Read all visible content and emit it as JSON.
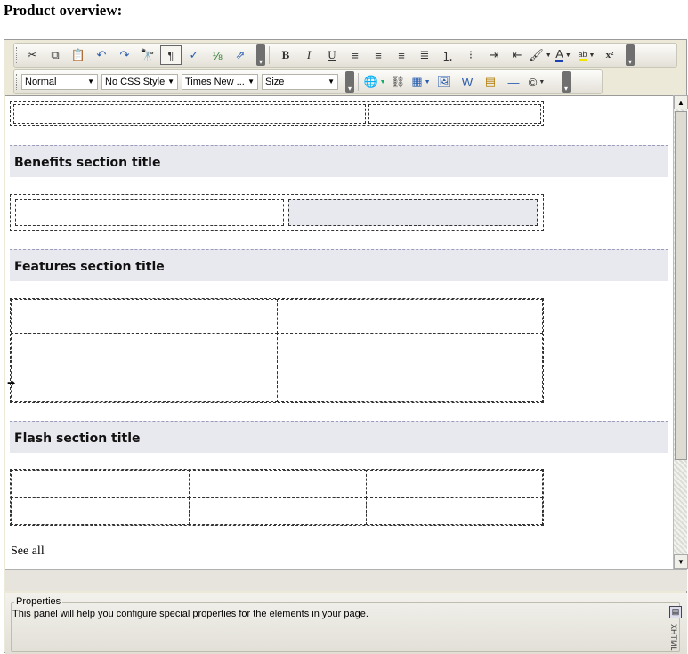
{
  "page": {
    "label": "Product overview:"
  },
  "toolbar": {
    "format_select": "Normal",
    "css_select": "No CSS Style",
    "font_select": "Times New ...",
    "size_select": "Size",
    "bold_glyph": "B",
    "italic_glyph": "I",
    "underline_glyph": "U",
    "font_color_glyph": "A",
    "highlight_glyph": "ab",
    "superscript_glyph": "x²",
    "copyright_glyph": "©"
  },
  "sections": {
    "benefits_title": "Benefits section title",
    "features_title": "Features section title",
    "flash_title": "Flash section title"
  },
  "content": {
    "see_all": "See all"
  },
  "properties": {
    "title": "Properties",
    "description": "This panel will help you configure special properties for the elements in your page.",
    "vertical_label": "XHTML"
  },
  "colors": {
    "section_bg": "#e8e8ef",
    "toolbar_bg": "#ece9d8"
  }
}
